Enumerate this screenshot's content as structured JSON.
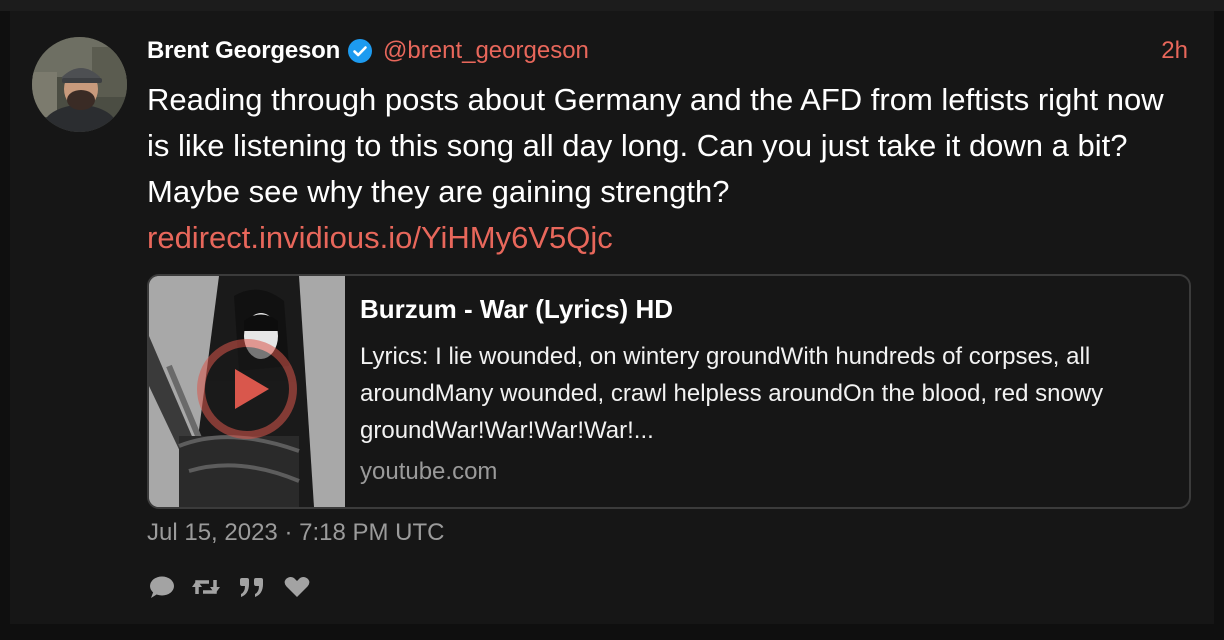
{
  "tweet": {
    "fullname": "Brent Georgeson",
    "username": "@brent_georgeson",
    "time": "2h",
    "text": "Reading through posts about Germany and the AFD from leftists right now is like listening to this song all day long. Can you just take it down a bit? Maybe see why they are gaining strength?",
    "link": "redirect.invidious.io/YiHMy6V5Qjc",
    "date": "Jul 15, 2023 · 7:18 PM UTC"
  },
  "card": {
    "title": "Burzum - War (Lyrics) HD",
    "description": "Lyrics: I lie wounded, on wintery groundWith hundreds of corpses, all aroundMany wounded, crawl helpless aroundOn the blood, red snowy groundWar!War!War!War!...",
    "domain": "youtube.com"
  },
  "icons": {
    "verified": "verified-badge-icon",
    "play": "play-icon",
    "reply": "reply-icon",
    "retweet": "retweet-icon",
    "quote": "quote-icon",
    "like": "heart-icon"
  },
  "colors": {
    "background": "#161616",
    "accent": "#e8675b",
    "text": "#ffffff",
    "muted": "#9b9b9b",
    "verified": "#1d9bf0"
  }
}
